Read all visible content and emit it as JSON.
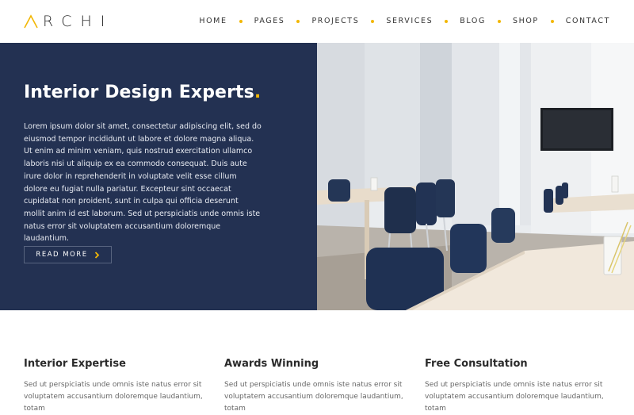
{
  "header": {
    "logo_text": "RCHI",
    "nav": [
      {
        "label": "HOME"
      },
      {
        "label": "PAGES"
      },
      {
        "label": "PROJECTS"
      },
      {
        "label": "SERVICES"
      },
      {
        "label": "BLOG"
      },
      {
        "label": "SHOP"
      },
      {
        "label": "CONTACT"
      }
    ],
    "accent_color": "#f2b705"
  },
  "hero": {
    "title": "Interior Design Experts",
    "title_accent": ".",
    "text": "Lorem ipsum dolor sit amet, consectetur adipiscing elit, sed do eiusmod tempor incididunt ut labore et dolore magna aliqua. Ut enim ad minim veniam, quis nostrud exercitation ullamco laboris nisi ut aliquip ex ea commodo consequat. Duis aute irure dolor in reprehenderit in voluptate velit esse cillum dolore eu fugiat nulla pariatur. Excepteur sint occaecat cupidatat non proident, sunt in culpa qui officia deserunt mollit anim id est laborum. Sed ut perspiciatis unde omnis iste natus error sit voluptatem accusantium doloremque laudantium.",
    "button_label": "READ MORE",
    "panel_color": "#233152"
  },
  "features": [
    {
      "title": "Interior Expertise",
      "text": "Sed ut perspiciatis unde omnis iste natus error sit voluptatem accusantium doloremque laudantium, totam"
    },
    {
      "title": "Awards Winning",
      "text": "Sed ut perspiciatis unde omnis iste natus error sit voluptatem accusantium doloremque laudantium, totam"
    },
    {
      "title": "Free Consultation",
      "text": "Sed ut perspiciatis unde omnis iste natus error sit voluptatem accusantium doloremque laudantium, totam"
    }
  ]
}
